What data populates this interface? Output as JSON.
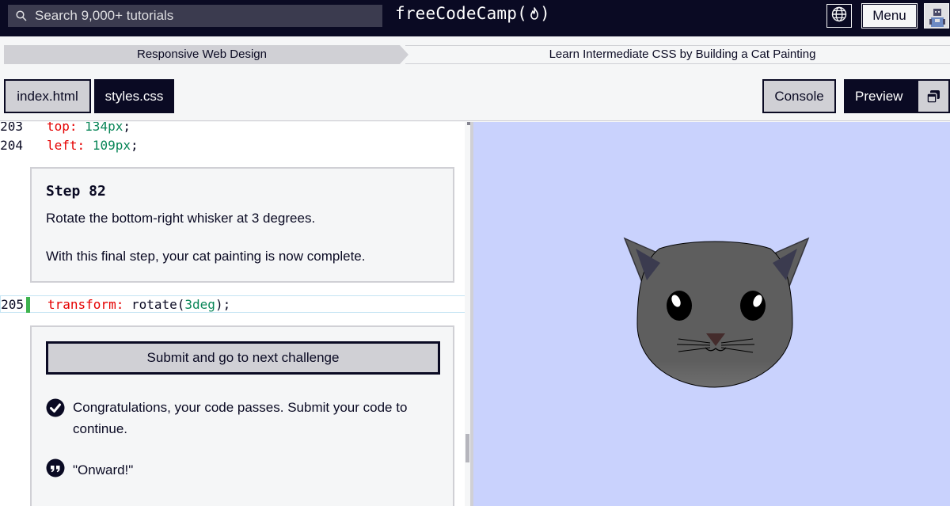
{
  "nav": {
    "search_placeholder": "Search 9,000+ tutorials",
    "logo_text": "freeCodeCamp(",
    "logo_close": ")",
    "menu_label": "Menu"
  },
  "breadcrumbs": {
    "superblock": "Responsive Web Design",
    "block": "Learn Intermediate CSS by Building a Cat Painting"
  },
  "tabs": {
    "index_label": "index.html",
    "styles_label": "styles.css",
    "console_label": "Console",
    "preview_label": "Preview"
  },
  "editor": {
    "lines": [
      {
        "number": "203",
        "prop": "top:",
        "value": "134px",
        "end": ";"
      },
      {
        "number": "204",
        "prop": "left:",
        "value": "109px",
        "end": ";"
      }
    ],
    "active_line": {
      "number": "205",
      "prop": "transform:",
      "fn_open": "rotate(",
      "value": "3deg",
      "fn_close": ");"
    }
  },
  "instructions": {
    "step_title": "Step 82",
    "paragraph_1": "Rotate the bottom-right whisker at 3 degrees.",
    "paragraph_2": "With this final step, your cat painting is now complete."
  },
  "result": {
    "submit_label": "Submit and go to next challenge",
    "pass_message": "Congratulations, your code passes. Submit your code to continue.",
    "quote": "\"Onward!\""
  },
  "colors": {
    "nav_bg": "#0a0a23",
    "preview_bg": "#c9d2fd",
    "cat_head": "#5e5e5e",
    "css_property": "#e50000",
    "css_value": "#098658",
    "pass_indicator": "#3eb34f"
  },
  "icons": {
    "search": "search-icon",
    "flame": "flame-icon",
    "globe": "globe-icon",
    "avatar": "avatar-icon",
    "preview_window": "preview-window-icon",
    "pass": "check-circle-icon",
    "quote": "quote-icon"
  }
}
